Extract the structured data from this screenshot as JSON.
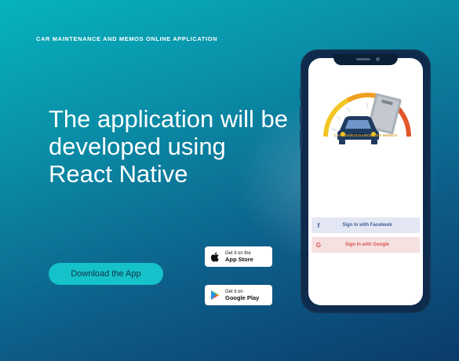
{
  "kicker": "CAR MAINTENANCE AND MEMOS ONLINE APPLICATION",
  "headline": "The application will be developed using React Native",
  "download_button": "Download the App",
  "badges": {
    "apple": {
      "small": "Get it on the",
      "big": "App Store",
      "icon": "apple-icon"
    },
    "google": {
      "small": "Get it on",
      "big": "Google Play",
      "icon": "google-play-icon"
    }
  },
  "phone": {
    "logo_caption": "CAR MAINTENANCE AND MEMOS",
    "facebook": {
      "icon": "f",
      "label": "Sign In with Facebook"
    },
    "google": {
      "icon": "G",
      "label": "Sign In with Google"
    }
  },
  "colors": {
    "button": "#16c2c9",
    "facebook": "#3b5998",
    "google": "#d9534f"
  }
}
